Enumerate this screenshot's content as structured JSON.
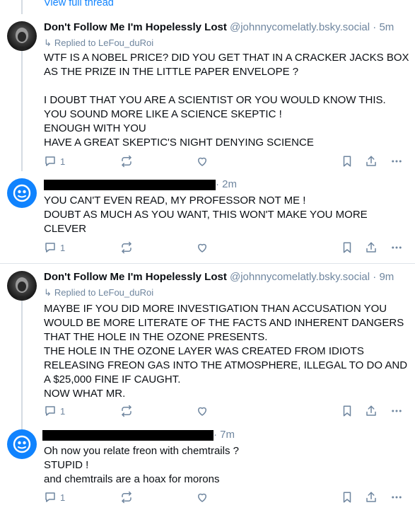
{
  "thread": {
    "view_full_thread": "View full thread"
  },
  "posts": [
    {
      "display_name": "Don't Follow Me I'm Hopelessly Lost",
      "handle": "@johnnycomelatly.bsky.social",
      "separator": "·",
      "time": "5m",
      "replied_to": "Replied to LeFou_duRoi",
      "text": "WTF IS A NOBEL PRICE? DID YOU GET THAT IN A CRACKER JACKS BOX\nAS THE PRIZE IN THE LITTLE PAPER ENVELOPE ?\n\nI DOUBT THAT YOU ARE A SCIENTIST OR YOU WOULD KNOW THIS.\nYOU SOUND MORE LIKE A SCIENCE SKEPTIC !\nENOUGH WITH YOU\nHAVE A GREAT SKEPTIC'S NIGHT DENYING SCIENCE",
      "reply_count": "1"
    },
    {
      "display_name": "",
      "separator": "·",
      "time": "2m",
      "text": "YOU CAN'T EVEN READ, MY PROFESSOR NOT ME !\nDOUBT AS MUCH AS YOU WANT, THIS WON'T MAKE YOU MORE\nCLEVER",
      "reply_count": "1"
    },
    {
      "display_name": "Don't Follow Me I'm Hopelessly Lost",
      "handle": "@johnnycomelatly.bsky.social",
      "separator": "·",
      "time": "9m",
      "replied_to": "Replied to LeFou_duRoi",
      "text": "MAYBE IF YOU DID MORE INVESTIGATION THAN ACCUSATION YOU\nWOULD BE MORE LITERATE OF THE FACTS AND INHERENT DANGERS\nTHAT THE HOLE IN THE OZONE PRESENTS.\nTHE HOLE IN THE OZONE LAYER WAS CREATED FROM IDIOTS\nRELEASING FREON GAS INTO THE ATMOSPHERE, ILLEGAL TO DO AND\nA $25,000 FINE IF CAUGHT.\nNOW WHAT MR.",
      "reply_count": "1"
    },
    {
      "display_name": "",
      "separator": "·",
      "time": "7m",
      "text": "Oh now you relate freon with chemtrails ?\nSTUPID !\nand chemtrails are a hoax for morons",
      "reply_count": "1"
    }
  ],
  "icons": {
    "reply": "speech-bubble-icon",
    "repost": "repost-arrows-icon",
    "like": "heart-icon",
    "bookmark": "bookmark-icon",
    "share": "share-icon",
    "more": "ellipsis-icon"
  },
  "colors": {
    "accent": "#1083fe",
    "muted": "#6f869f",
    "text": "#0b0f14",
    "divider": "#dfe4ea"
  }
}
